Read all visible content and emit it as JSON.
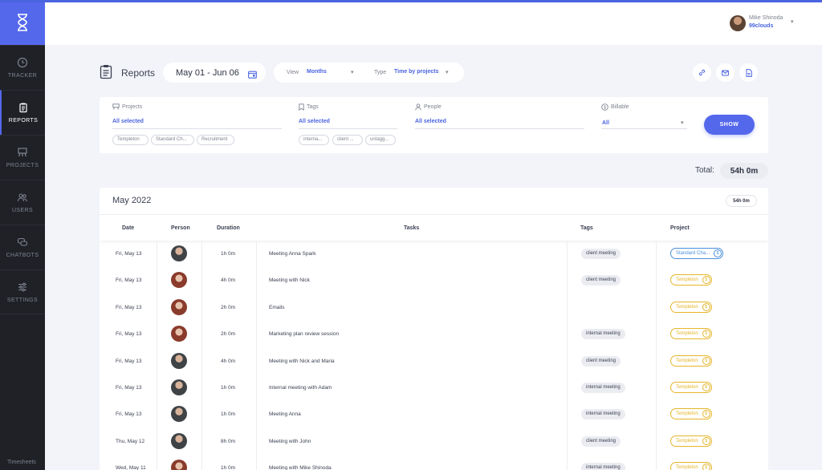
{
  "sidebar": {
    "items": [
      {
        "label": "TRACKER",
        "icon": "clock-icon"
      },
      {
        "label": "REPORTS",
        "icon": "clipboard-icon"
      },
      {
        "label": "PROJECTS",
        "icon": "easel-icon"
      },
      {
        "label": "USERS",
        "icon": "users-icon"
      },
      {
        "label": "CHATBOTS",
        "icon": "chat-icon"
      },
      {
        "label": "SETTINGS",
        "icon": "sliders-icon"
      }
    ],
    "active": "REPORTS",
    "footer": "Timesheets"
  },
  "header": {
    "user_name": "Mike Shinoda",
    "org": "99clouds",
    "caret": "▾"
  },
  "toolbar": {
    "title": "Reports",
    "date_range": "May 01 - Jun 06",
    "view_label": "View",
    "view_value": "Months",
    "type_label": "Type",
    "type_value": "Time by projects",
    "caret": "▾"
  },
  "filters": {
    "projects": {
      "label": "Projects",
      "value": "All selected",
      "chips": [
        "Templeton",
        "Standard Ch...",
        "Recruitment"
      ]
    },
    "tags": {
      "label": "Tags",
      "value": "All selected",
      "chips": [
        "interna...",
        "client ...",
        "untagg..."
      ]
    },
    "people": {
      "label": "People",
      "value": "All selected"
    },
    "billable": {
      "label": "Billable",
      "value": "All"
    },
    "show_label": "SHOW"
  },
  "total": {
    "label": "Total:",
    "value": "54h 0m"
  },
  "report": {
    "month": "May 2022",
    "month_total": "54h 0m",
    "columns": [
      "Date",
      "Person",
      "Duration",
      "Tasks",
      "Tags",
      "Project"
    ],
    "rows": [
      {
        "date": "Fri, May 13",
        "avatar": "m",
        "duration": "1h 0m",
        "task": "Meeting Anna Spark",
        "tag": "client meeting",
        "project": "Standard Cha...",
        "project_color": "#4a8fd9"
      },
      {
        "date": "Fri, May 13",
        "avatar": "f",
        "duration": "4h 0m",
        "task": "Meeting with Nick",
        "tag": "client meeting",
        "project": "Templeton",
        "project_color": "#e5b52a"
      },
      {
        "date": "Fri, May 13",
        "avatar": "f",
        "duration": "2h 0m",
        "task": "Emails",
        "tag": "",
        "project": "Templeton",
        "project_color": "#e5b52a"
      },
      {
        "date": "Fri, May 13",
        "avatar": "f",
        "duration": "2h 0m",
        "task": "Marketing plan review session",
        "tag": "internal meeting",
        "project": "Templeton",
        "project_color": "#e5b52a"
      },
      {
        "date": "Fri, May 13",
        "avatar": "m",
        "duration": "4h 0m",
        "task": "Meeting with Nick and Maria",
        "tag": "client meeting",
        "project": "Templeton",
        "project_color": "#e5b52a"
      },
      {
        "date": "Fri, May 13",
        "avatar": "m",
        "duration": "1h 0m",
        "task": "Internal meeting with Adam",
        "tag": "internal meeting",
        "project": "Templeton",
        "project_color": "#e5b52a"
      },
      {
        "date": "Fri, May 13",
        "avatar": "m",
        "duration": "1h 0m",
        "task": "Meeting Anna",
        "tag": "internal meeting",
        "project": "Templeton",
        "project_color": "#e5b52a"
      },
      {
        "date": "Thu, May 12",
        "avatar": "m",
        "duration": "8h 0m",
        "task": "Meeting with John",
        "tag": "client meeting",
        "project": "Templeton",
        "project_color": "#e5b52a"
      },
      {
        "date": "Wed, May 11",
        "avatar": "f",
        "duration": "1h 0m",
        "task": "Meeting with Mike Shinoda",
        "tag": "internal meeting",
        "project": "Templeton",
        "project_color": "#e5b52a"
      }
    ],
    "dollar": "$"
  },
  "colors": {
    "accent": "#5468ec",
    "sidebar": "#1f2127",
    "standard": "#4a8fd9",
    "templeton": "#e5b52a"
  }
}
